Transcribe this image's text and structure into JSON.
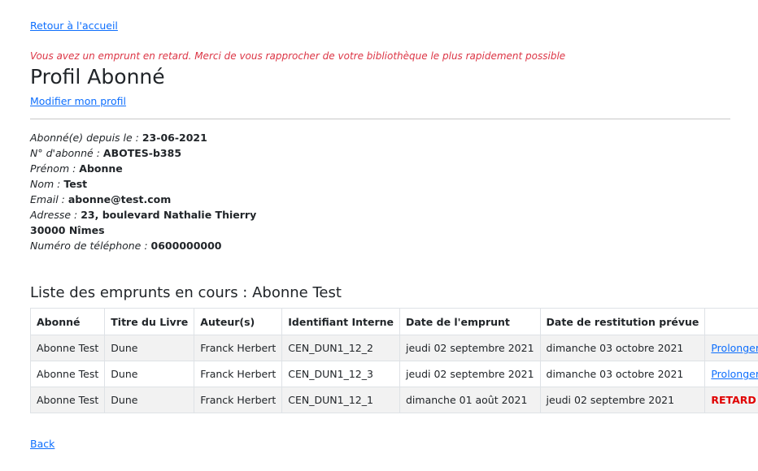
{
  "nav": {
    "home_link": "Retour à l'accueil",
    "back_link": "Back"
  },
  "alert": {
    "message": "Vous avez un emprunt en retard. Merci de vous rapprocher de votre bibliothèque le plus rapidement possible",
    "color": "#dc3545"
  },
  "profile": {
    "title": "Profil Abonné",
    "edit_link": "Modifier mon profil",
    "fields": {
      "since_label": "Abonné(e) depuis le : ",
      "since_value": "23-06-2021",
      "number_label": "N° d'abonné : ",
      "number_value": "ABOTES-b385",
      "firstname_label": "Prénom : ",
      "firstname_value": "Abonne",
      "lastname_label": "Nom : ",
      "lastname_value": "Test",
      "email_label": "Email : ",
      "email_value": "abonne@test.com",
      "address_label": "Adresse : ",
      "address_line1": "23, boulevard Nathalie Thierry",
      "address_line2": "30000 Nîmes",
      "phone_label": "Numéro de téléphone : ",
      "phone_value": "0600000000"
    }
  },
  "loans": {
    "title": "Liste des emprunts en cours : Abonne Test",
    "headers": [
      "Abonné",
      "Titre du Livre",
      "Auteur(s)",
      "Identifiant Interne",
      "Date de l'emprunt",
      "Date de restitution prévue",
      ""
    ],
    "rows": [
      {
        "subscriber": "Abonne Test",
        "book": "Dune",
        "author": "Franck Herbert",
        "id": "CEN_DUN1_12_2",
        "loan_date": "jeudi 02 septembre 2021",
        "due_date": "dimanche 03 octobre 2021",
        "action": "Prolonger"
      },
      {
        "subscriber": "Abonne Test",
        "book": "Dune",
        "author": "Franck Herbert",
        "id": "CEN_DUN1_12_3",
        "loan_date": "jeudi 02 septembre 2021",
        "due_date": "dimanche 03 octobre 2021",
        "action": "Prolonger"
      },
      {
        "subscriber": "Abonne Test",
        "book": "Dune",
        "author": "Franck Herbert",
        "id": "CEN_DUN1_12_1",
        "loan_date": "dimanche 01 août 2021",
        "due_date": "jeudi 02 septembre 2021",
        "status": "RETARD"
      }
    ]
  },
  "colors": {
    "link": "#0d6efd",
    "late": "#e00000"
  }
}
